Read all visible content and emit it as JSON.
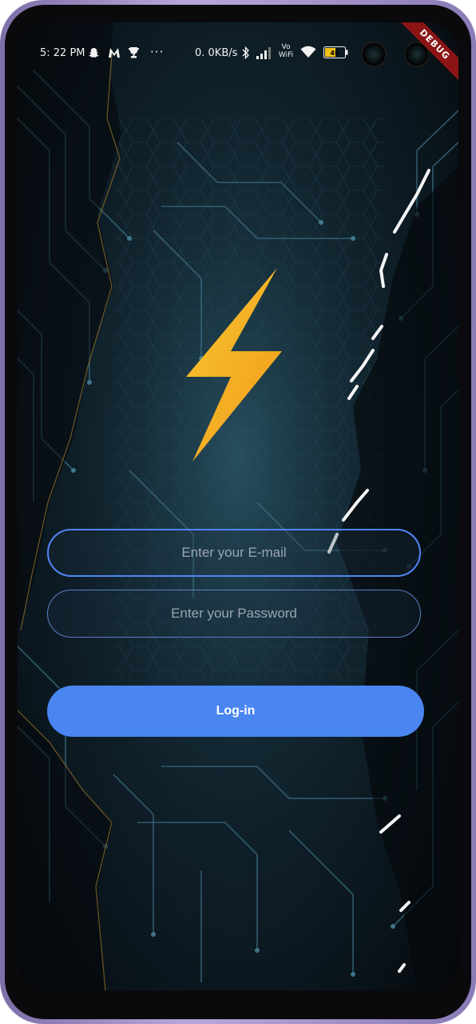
{
  "status_bar": {
    "time": "5: 22 PM",
    "data_speed": "0. 0KB/s",
    "vo_wifi": "Vo WiFi",
    "battery_level": "49",
    "icons": [
      "snapchat-icon",
      "gmail-icon",
      "trophy-icon",
      "more-dots-icon",
      "bluetooth-icon",
      "signal-icon",
      "vowifi-icon",
      "wifi-icon",
      "battery-icon"
    ],
    "more_dots": "···"
  },
  "debug_banner": {
    "label": "DEBUG"
  },
  "logo": {
    "icon": "lightning-bolt-icon",
    "color_top": "#f7c02b",
    "color_bottom": "#f29a1c"
  },
  "form": {
    "email_placeholder": "Enter your E-mail",
    "password_placeholder": "Enter your Password",
    "login_label": "Log-in"
  },
  "colors": {
    "accent": "#4a86f2",
    "email_border": "#4f86f7",
    "background": "#0b171f"
  }
}
